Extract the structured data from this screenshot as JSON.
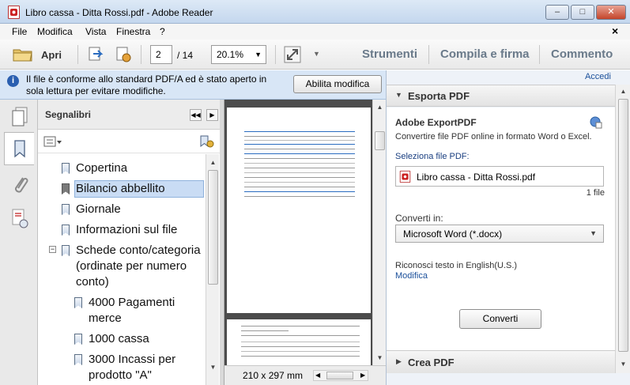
{
  "window": {
    "title": "Libro cassa - Ditta Rossi.pdf - Adobe Reader",
    "controls": [
      "–",
      "□",
      "✕"
    ]
  },
  "menubar": {
    "items": [
      "File",
      "Modifica",
      "Vista",
      "Finestra",
      "?"
    ],
    "close": "×"
  },
  "toolbar": {
    "open_label": "Apri",
    "page_current": "2",
    "page_total": "/ 14",
    "zoom": "20.1%",
    "tabs": [
      "Strumenti",
      "Compila e firma",
      "Commento"
    ]
  },
  "notice": {
    "line1": "Il file è conforme allo standard PDF/A ed è stato aperto in",
    "line2": "sola lettura per evitare modifiche.",
    "button": "Abilita modifica"
  },
  "bookmarks": {
    "title": "Segnalibri",
    "items": [
      {
        "label": "Copertina"
      },
      {
        "label": "Bilancio abbellito"
      },
      {
        "label": "Giornale"
      },
      {
        "label": "Informazioni sul file"
      },
      {
        "label": "Schede conto/categoria",
        "label2": "(ordinate per numero",
        "label3": "conto)"
      },
      {
        "label": "4000 Pagamenti",
        "label2": "merce"
      },
      {
        "label": "1000 cassa"
      },
      {
        "label": "3000 Incassi per",
        "label2": "prodotto \"A\""
      }
    ],
    "selected_index": 1
  },
  "thumbnail": {
    "page_size": "210 x 297 mm"
  },
  "right_panel": {
    "link": "Accedi",
    "export_title": "Esporta PDF",
    "service_title": "Adobe ExportPDF",
    "service_desc": "Convertire file PDF online in formato Word o Excel.",
    "select_label": "Seleziona file PDF:",
    "file_name": "Libro cassa - Ditta Rossi.pdf",
    "file_count": "1 file",
    "convert_to_label": "Converti in:",
    "format": "Microsoft Word (*.docx)",
    "ocr_text": "Riconosci testo in English(U.S.)",
    "ocr_link": "Modifica",
    "convert_button": "Converti",
    "create_title": "Crea PDF"
  },
  "colors": {
    "accent_link": "#1a4f9a",
    "selected_bookmark": "#c9dcf4",
    "notice_bg": "#d8e6f6"
  }
}
